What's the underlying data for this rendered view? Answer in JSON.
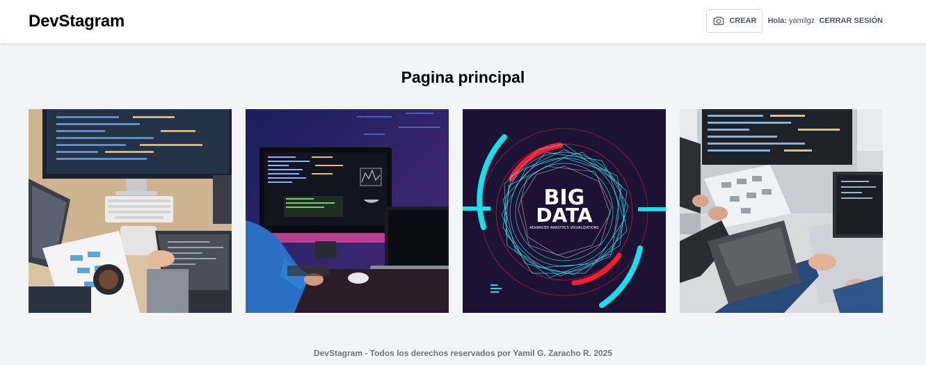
{
  "header": {
    "brand": "DevStagram",
    "create_label": "CREAR",
    "greeting_label": "Hola:",
    "username": "yamilgz",
    "logout_label": "CERRAR SESIÓN"
  },
  "main": {
    "title": "Pagina principal",
    "posts": [
      {
        "name": "post-developer-desk",
        "icon": "desk-photo"
      },
      {
        "name": "post-monitor-code",
        "icon": "monitor-photo"
      },
      {
        "name": "post-big-data",
        "icon": "bigdata-photo",
        "caption_1": "BIG",
        "caption_2": "DATA",
        "caption_3": "ADVANCED ANALYTICS VISUALIZATIONS"
      },
      {
        "name": "post-programmers-laptop",
        "icon": "laptop-photo"
      }
    ]
  },
  "footer": {
    "text": "DevStagram - Todos los derechos reservados por Yamil G. Zaracho R. 2025"
  }
}
